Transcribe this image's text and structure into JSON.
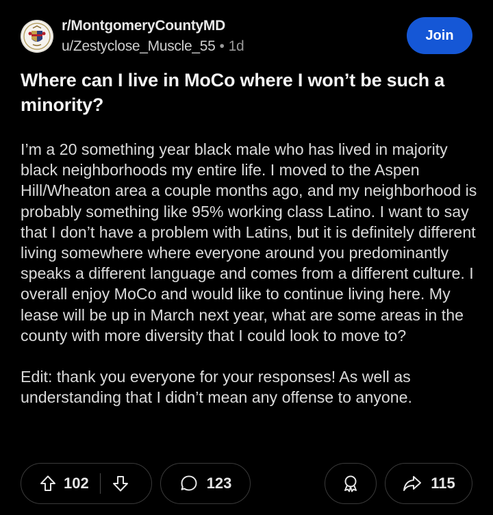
{
  "post": {
    "subreddit": "r/MontgomeryCountyMD",
    "author": "u/Zestyclose_Muscle_55",
    "separator": "•",
    "age": "1d",
    "join_label": "Join",
    "title": "Where can I live in MoCo where I won’t be such a minority?",
    "body_paragraphs": [
      "I’m a 20 something year black male who has lived in majority black neighborhoods my entire life. I moved to the Aspen Hill/Wheaton area a couple months ago, and my neighborhood is probably something like 95% working class Latino. I want to say that I don’t have a problem with Latins, but it is definitely different living somewhere where everyone around you predominantly speaks a different language and comes from a different culture. I overall enjoy MoCo and would like to continue living here. My lease will be up in March next year, what are some areas in the county with more diversity that I could look to move to?",
      "Edit: thank you everyone for your responses! As well as understanding that I didn’t mean any offense to anyone."
    ]
  },
  "actions": {
    "upvotes": "102",
    "comments": "123",
    "shares": "115"
  },
  "icons": {
    "avatar": "county-seal-icon",
    "upvote": "arrow-up-icon",
    "downvote": "arrow-down-icon",
    "comment": "comment-bubble-icon",
    "award": "award-icon",
    "share": "share-arrow-icon"
  },
  "colors": {
    "background": "#000000",
    "join_button": "#1557D6",
    "text": "#F2F2F2",
    "muted": "#9A9A9A",
    "pill_border": "#3A3A3A"
  }
}
